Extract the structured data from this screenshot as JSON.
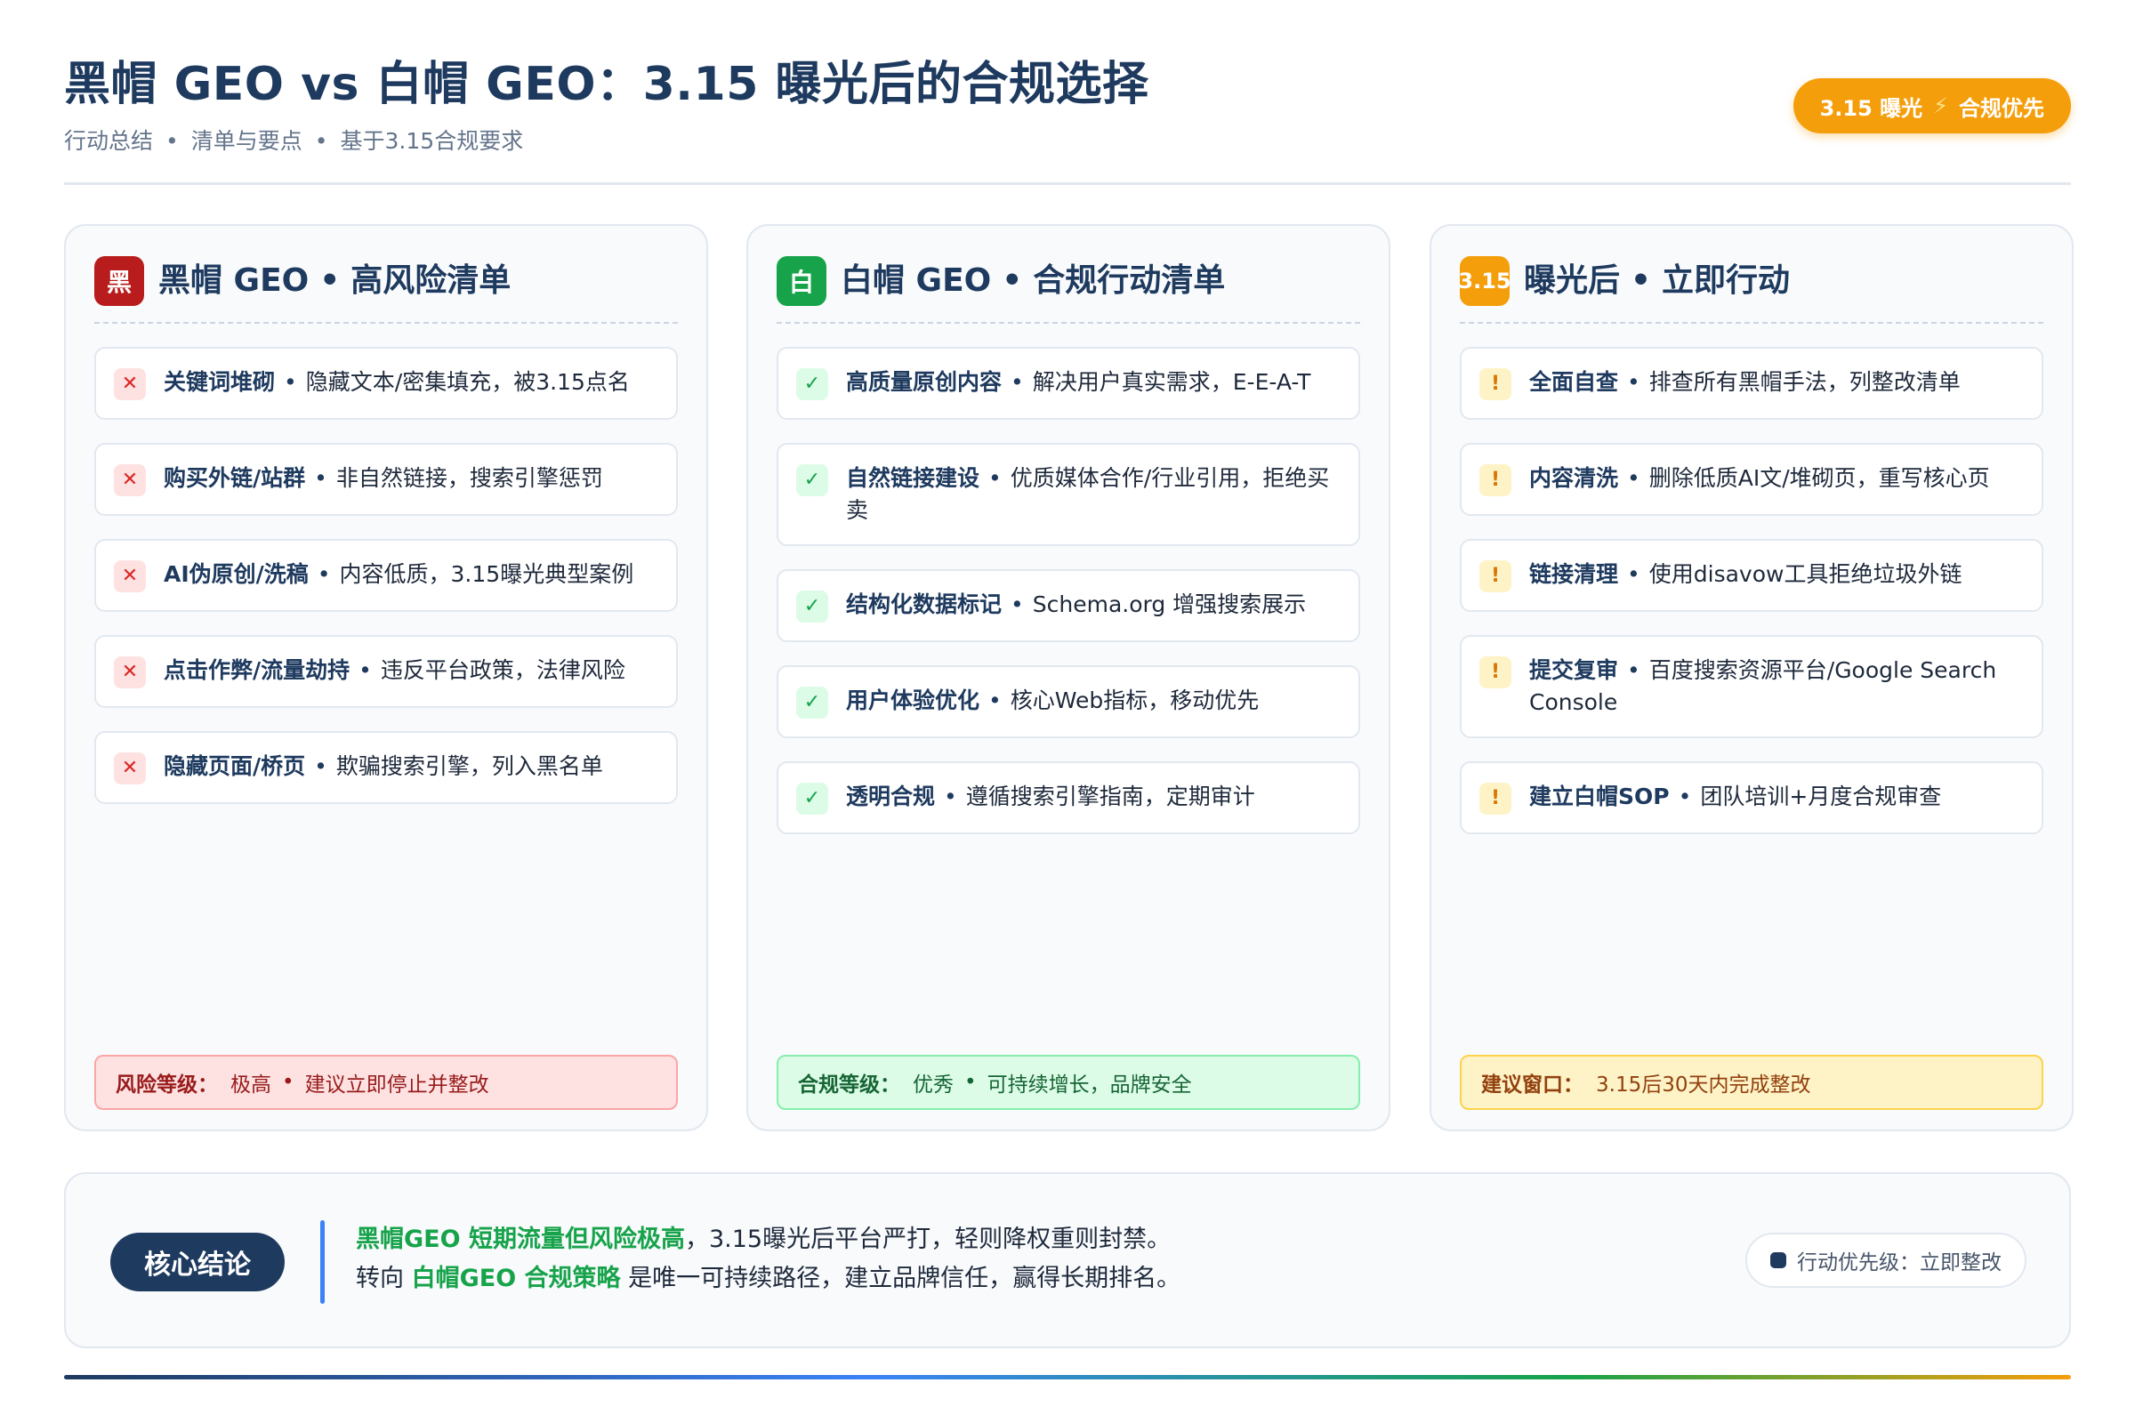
{
  "header": {
    "title": "黑帽 GEO vs 白帽 GEO：3.15 曝光后的合规选择",
    "subtitle_parts": [
      "行动总结",
      "清单与要点",
      "基于3.15合规要求"
    ],
    "separator": "•",
    "badge": {
      "left": "3.15 曝光",
      "icon": "lightning-bolt-icon",
      "right": "合规优先",
      "color": "#f59e0b"
    }
  },
  "columns": [
    {
      "icon_text": "黑",
      "title": "黑帽 GEO",
      "subtitle": "高风险清单",
      "mark": "✕",
      "items": [
        {
          "name": "关键词堆砌",
          "desc": "隐藏文本/密集填充，被3.15点名"
        },
        {
          "name": "购买外链/站群",
          "desc": "非自然链接，搜索引擎惩罚"
        },
        {
          "name": "AI伪原创/洗稿",
          "desc": "内容低质，3.15曝光典型案例"
        },
        {
          "name": "点击作弊/流量劫持",
          "desc": "违反平台政策，法律风险"
        },
        {
          "name": "隐藏页面/桥页",
          "desc": "欺骗搜索引擎，列入黑名单"
        }
      ],
      "footer": {
        "label": "风险等级：",
        "value": "极高",
        "note": "建议立即停止并整改"
      }
    },
    {
      "icon_text": "白",
      "title": "白帽 GEO",
      "subtitle": "合规行动清单",
      "mark": "✓",
      "items": [
        {
          "name": "高质量原创内容",
          "desc": "解决用户真实需求，E-E-A-T"
        },
        {
          "name": "自然链接建设",
          "desc": "优质媒体合作/行业引用，拒绝买卖"
        },
        {
          "name": "结构化数据标记",
          "desc": "Schema.org 增强搜索展示"
        },
        {
          "name": "用户体验优化",
          "desc": "核心Web指标，移动优先"
        },
        {
          "name": "透明合规",
          "desc": "遵循搜索引擎指南，定期审计"
        }
      ],
      "footer": {
        "label": "合规等级：",
        "value": "优秀",
        "note": "可持续增长，品牌安全"
      }
    },
    {
      "icon_text": "3.15",
      "title": "曝光后",
      "subtitle": "立即行动",
      "mark": "!",
      "items": [
        {
          "name": "全面自查",
          "desc": "排查所有黑帽手法，列整改清单"
        },
        {
          "name": "内容清洗",
          "desc": "删除低质AI文/堆砌页，重写核心页"
        },
        {
          "name": "链接清理",
          "desc": "使用disavow工具拒绝垃圾外链"
        },
        {
          "name": "提交复审",
          "desc": "百度搜索资源平台/Google Search Console"
        },
        {
          "name": "建立白帽SOP",
          "desc": "团队培训+月度合规审查"
        }
      ],
      "footer": {
        "label": "建议窗口：",
        "value": "3.15后30天内完成整改"
      }
    }
  ],
  "summary": {
    "label": "核心结论",
    "line1_highlight": "黑帽GEO 短期流量但风险极高",
    "line1_rest": "，3.15曝光后平台严打，轻则降权重则封禁。",
    "line2_prefix": "转向 ",
    "line2_highlight": "白帽GEO 合规策略",
    "line2_rest": " 是唯一可持续路径，建立品牌信任，赢得长期排名。",
    "priority": "行动优先级：立即整改"
  },
  "colors": {
    "navy": "#1e3a5f",
    "red": "#b91c1c",
    "green": "#16a34a",
    "orange": "#f59e0b",
    "blue": "#3b82f6"
  }
}
